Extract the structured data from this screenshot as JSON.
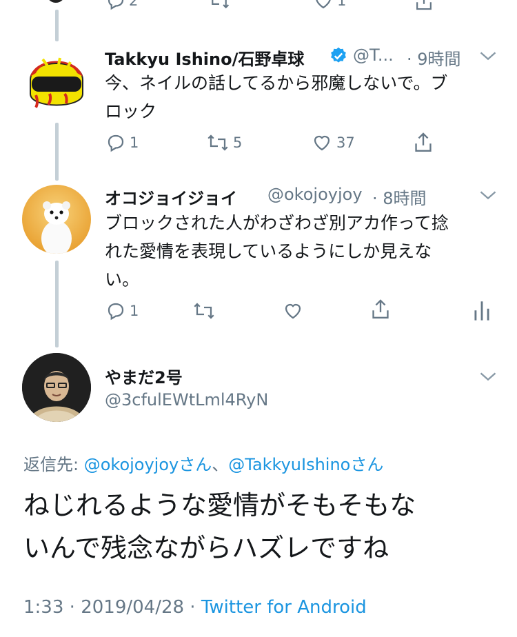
{
  "top_actions": {
    "reply_count": "2",
    "like_count": "1"
  },
  "tweets": [
    {
      "name": "Takkyu Ishino/石野卓球",
      "handle": "@T...",
      "time": "· 9時間",
      "text_lines": [
        "今、ネイルの話してるから邪魔しないで。ブ",
        "ロック"
      ],
      "reply_count": "1",
      "retweet_count": "5",
      "like_count": "37"
    },
    {
      "name": "オコジョイジョイ",
      "handle": "@okojoyjoy",
      "time": "· 8時間",
      "text_lines": [
        "ブロックされた人がわざわざ別アカ作って捻",
        "れた愛情を表現しているようにしか見えな",
        "い。"
      ],
      "reply_count": "1",
      "retweet_count": "",
      "like_count": ""
    }
  ],
  "main_tweet": {
    "name": "やまだ2号",
    "handle": "@3cfulEWtLml4RyN",
    "reply_prefix": "返信先: ",
    "reply_user1": "@okojoyjoyさん",
    "reply_sep": "、",
    "reply_user2": "@TakkyuIshinoさん",
    "text_lines": [
      "ねじれるような愛情がそもそもな",
      "いんで残念ながらハズレですね"
    ],
    "time": "1:33",
    "dot1": " · ",
    "date": "2019/04/28",
    "dot2": " · ",
    "client": "Twitter for Android"
  },
  "colors": {
    "accent": "#1b95e0",
    "muted": "#657786",
    "line": "#c4cfd6"
  }
}
